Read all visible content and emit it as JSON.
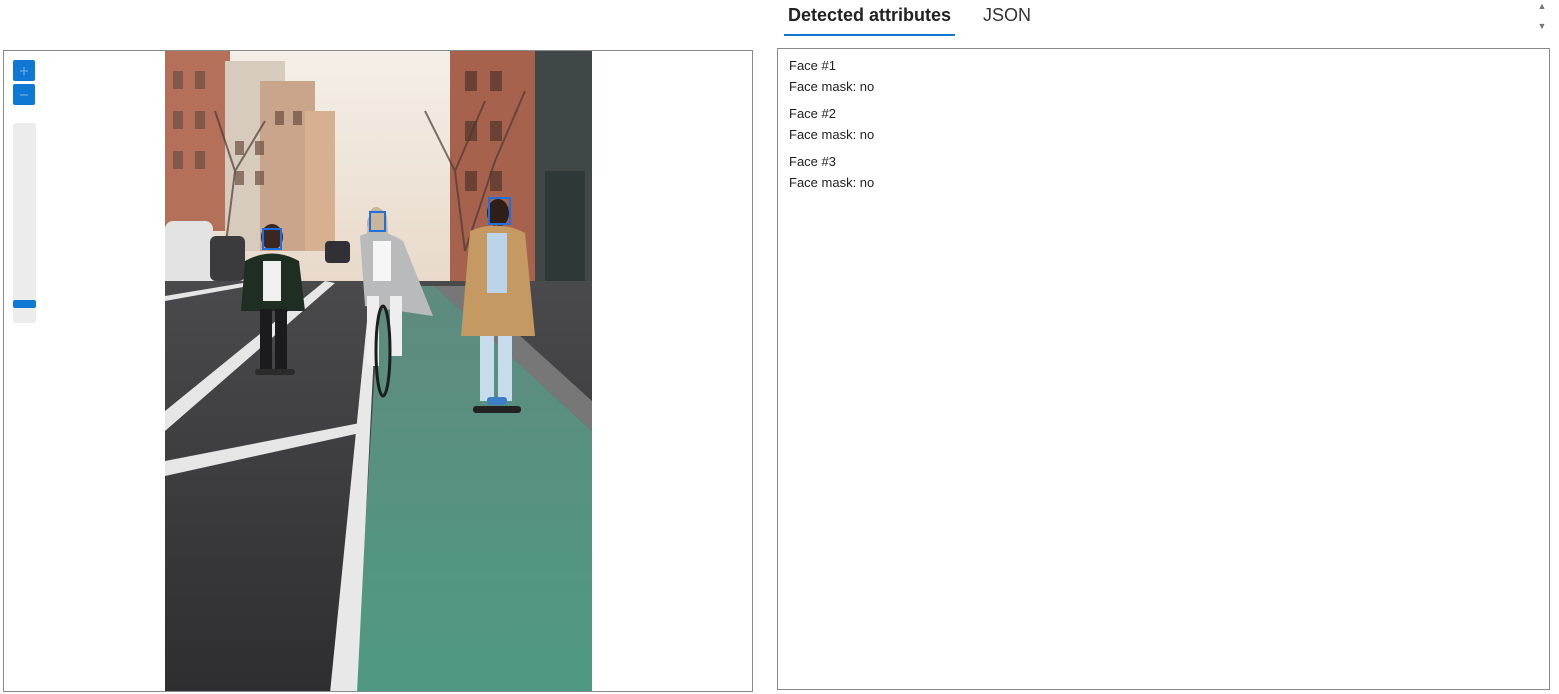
{
  "tabs": [
    {
      "label": "Detected attributes",
      "active": true
    },
    {
      "label": "JSON",
      "active": false
    }
  ],
  "viewer": {
    "zoom_level_fraction": 0.92,
    "face_box_color": "#1e6fe0"
  },
  "faces": [
    {
      "title": "Face #1",
      "attribute": "Face mask: no"
    },
    {
      "title": "Face #2",
      "attribute": "Face mask: no"
    },
    {
      "title": "Face #3",
      "attribute": "Face mask: no"
    }
  ],
  "colors": {
    "accent": "#0f78d4",
    "border": "#8a8a8a"
  },
  "icons": {
    "zoom_in": "plus-icon",
    "zoom_out": "minus-icon",
    "scroll_up": "caret-up-icon",
    "scroll_down": "caret-down-icon"
  }
}
